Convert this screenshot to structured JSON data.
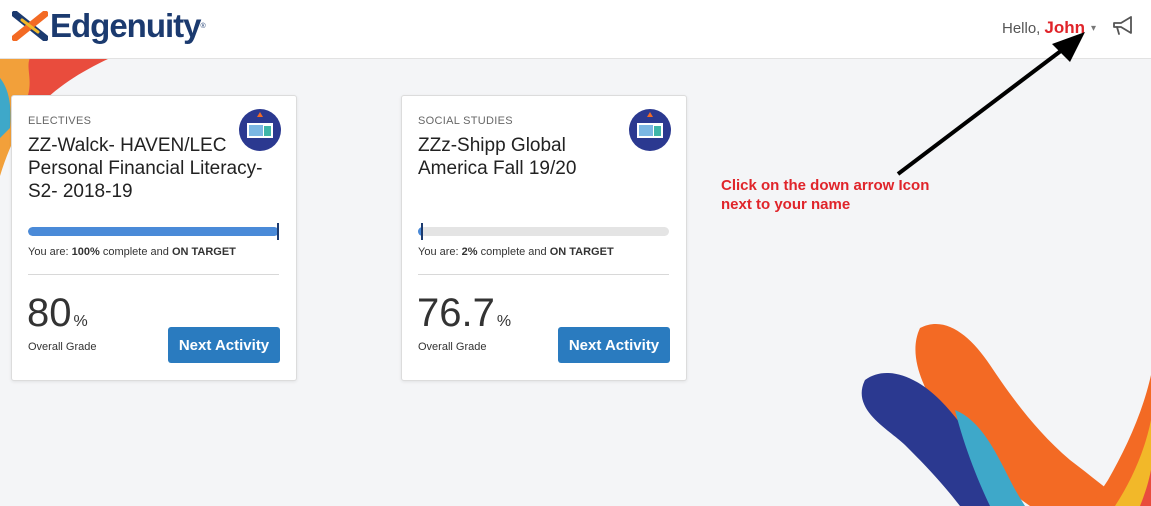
{
  "header": {
    "logo_text": "Edgenuity",
    "logo_tm": "®",
    "greeting": "Hello,",
    "user_name": "John",
    "caret": "▾"
  },
  "courses": [
    {
      "subject": "ELECTIVES",
      "title": "ZZ-Walck- HAVEN/LEC Personal Financial Literacy-S2- 2018-19",
      "progress_percent": 100,
      "progress_prefix": "You are: ",
      "progress_value": "100%",
      "progress_mid": " complete and ",
      "progress_status": "ON TARGET",
      "grade_value": "80",
      "grade_unit": "%",
      "grade_label": "Overall Grade",
      "button_label": "Next Activity"
    },
    {
      "subject": "SOCIAL STUDIES",
      "title": "ZZz-Shipp Global America Fall 19/20",
      "progress_percent": 2,
      "progress_prefix": "You are: ",
      "progress_value": "2%",
      "progress_mid": " complete and ",
      "progress_status": "ON TARGET",
      "grade_value": "76.7",
      "grade_unit": "%",
      "grade_label": "Overall Grade",
      "button_label": "Next Activity"
    }
  ],
  "annotation": {
    "text": "Click on the down arrow Icon next to your name"
  },
  "colors": {
    "brand_navy": "#1b3a6f",
    "accent_red": "#e0242a",
    "button_blue": "#2a7bbf",
    "progress_blue": "#4a8ad8"
  },
  "icons": {
    "logo": "edgenuity-x-logo",
    "megaphone": "megaphone-icon",
    "badge": "course-badge-icon",
    "caret": "chevron-down-icon"
  }
}
